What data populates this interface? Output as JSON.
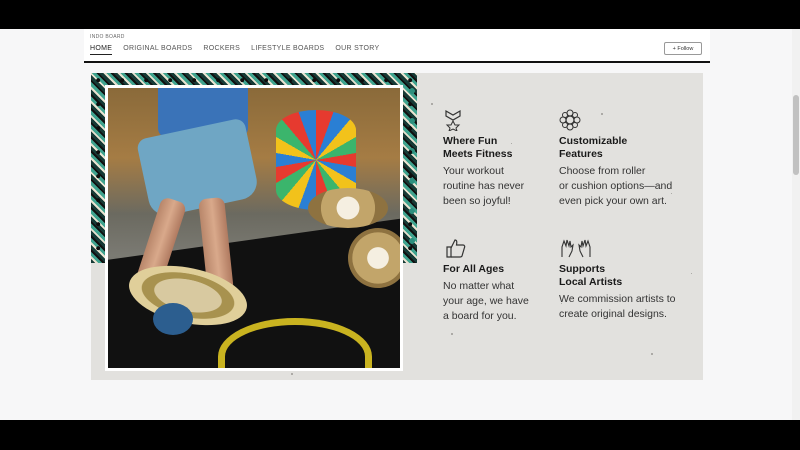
{
  "header": {
    "brand": "INDO BOARD",
    "nav": [
      "HOME",
      "ORIGINAL BOARDS",
      "ROCKERS",
      "LIFESTYLE BOARDS",
      "OUR STORY"
    ],
    "active_nav": "HOME",
    "follow_label": "+ Follow"
  },
  "features": [
    {
      "icon": "chevron-badge-icon",
      "title": "Where Fun\nMeets Fitness",
      "desc": "Your workout\nroutine has never\nbeen so joyful!"
    },
    {
      "icon": "gear-flower-icon",
      "title": "Customizable\nFeatures",
      "desc": "Choose from roller\nor cushion options—and\neven pick your own art."
    },
    {
      "icon": "thumbs-up-icon",
      "title": "For All Ages",
      "desc": "No matter what\nyour age, we have\na board for you."
    },
    {
      "icon": "raised-hands-icon",
      "title": "Supports\nLocal Artists",
      "desc": "We commission artists to\ncreate original designs."
    }
  ]
}
